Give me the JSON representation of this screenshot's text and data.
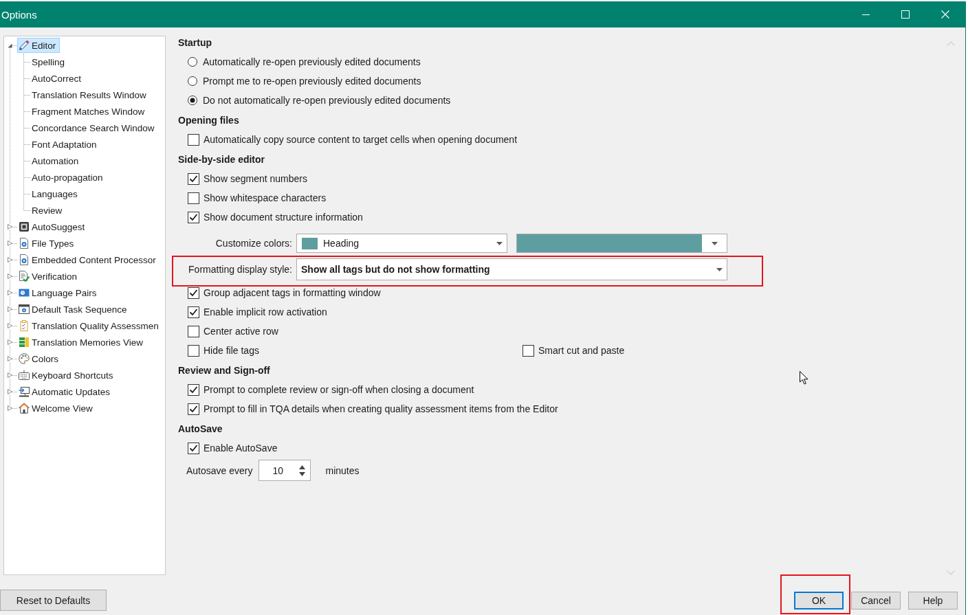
{
  "window": {
    "title": "Options"
  },
  "tree": [
    {
      "label": "Editor",
      "selected": true,
      "expanded": true,
      "children": [
        {
          "label": "Spelling",
          "selected": false
        },
        {
          "label": "AutoCorrect",
          "selected": false
        },
        {
          "label": "Translation Results Window",
          "selected": false
        },
        {
          "label": "Fragment Matches Window",
          "selected": false
        },
        {
          "label": "Concordance Search Window",
          "selected": false
        },
        {
          "label": "Font Adaptation",
          "selected": false
        },
        {
          "label": "Automation",
          "selected": false
        },
        {
          "label": "Auto-propagation",
          "selected": false
        },
        {
          "label": "Languages",
          "selected": false
        },
        {
          "label": "Review",
          "selected": false
        }
      ]
    },
    {
      "label": "AutoSuggest",
      "selected": false,
      "expanded": false
    },
    {
      "label": "File Types",
      "selected": false,
      "expanded": false
    },
    {
      "label": "Embedded Content Processor",
      "selected": false,
      "expanded": false
    },
    {
      "label": "Verification",
      "selected": false,
      "expanded": false
    },
    {
      "label": "Language Pairs",
      "selected": false,
      "expanded": false
    },
    {
      "label": "Default Task Sequence",
      "selected": false,
      "expanded": false
    },
    {
      "label": "Translation Quality Assessmen",
      "selected": false,
      "expanded": false
    },
    {
      "label": "Translation Memories View",
      "selected": false,
      "expanded": false
    },
    {
      "label": "Colors",
      "selected": false,
      "expanded": false
    },
    {
      "label": "Keyboard Shortcuts",
      "selected": false,
      "expanded": false
    },
    {
      "label": "Automatic Updates",
      "selected": false,
      "expanded": false
    },
    {
      "label": "Welcome View",
      "selected": false,
      "expanded": false
    }
  ],
  "sections": [
    {
      "title": "Startup",
      "options": [
        {
          "kind": "radio",
          "label": "Automatically re-open previously edited documents",
          "selected": false
        },
        {
          "kind": "radio",
          "label": "Prompt me to re-open previously edited documents",
          "selected": false
        },
        {
          "kind": "radio",
          "label": "Do not automatically re-open previously edited documents",
          "selected": true
        }
      ]
    },
    {
      "title": "Opening files",
      "options": [
        {
          "kind": "checkbox",
          "label": "Automatically copy source content to target cells when opening document",
          "checked": false
        }
      ]
    },
    {
      "title": "Side-by-side editor",
      "options": [
        {
          "kind": "checkbox",
          "label": "Show segment numbers",
          "checked": true
        },
        {
          "kind": "checkbox",
          "label": "Show whitespace characters",
          "checked": false
        },
        {
          "kind": "checkbox",
          "label": "Show document structure information",
          "checked": true
        },
        {
          "kind": "color_picker",
          "label": "Customize colors:",
          "value": "Heading",
          "color": "#5f9ea0"
        },
        {
          "kind": "dropdown",
          "label": "Formatting display style:",
          "value": "Show all tags but do not show formatting",
          "highlighted": true
        },
        {
          "kind": "checkbox",
          "label": "Group adjacent tags in formatting window",
          "checked": true
        },
        {
          "kind": "checkbox",
          "label": "Enable implicit row activation",
          "checked": true
        },
        {
          "kind": "checkbox",
          "label": "Center active row",
          "checked": false
        },
        {
          "kind": "checkbox_pair",
          "items": [
            {
              "label": "Hide file tags",
              "checked": false
            },
            {
              "label": "Smart cut and paste",
              "checked": false
            }
          ]
        }
      ]
    },
    {
      "title": "Review and Sign-off",
      "options": [
        {
          "kind": "checkbox",
          "label": "Prompt to complete review or sign-off when closing a document",
          "checked": true
        },
        {
          "kind": "checkbox",
          "label": "Prompt to fill in TQA details when creating quality assessment items from the Editor",
          "checked": true
        }
      ]
    },
    {
      "title": "AutoSave",
      "options": [
        {
          "kind": "checkbox",
          "label": "Enable AutoSave",
          "checked": true
        },
        {
          "kind": "spinner",
          "label": "Autosave every",
          "value": "10",
          "unit": "minutes"
        }
      ]
    }
  ],
  "footer": {
    "left_buttons": [
      {
        "label": "Reset to Defaults",
        "default": false,
        "highlighted": false
      }
    ],
    "right_buttons": [
      {
        "label": "OK",
        "default": true,
        "highlighted": true
      },
      {
        "label": "Cancel",
        "default": false,
        "highlighted": false
      },
      {
        "label": "Help",
        "default": false,
        "highlighted": false
      }
    ]
  }
}
